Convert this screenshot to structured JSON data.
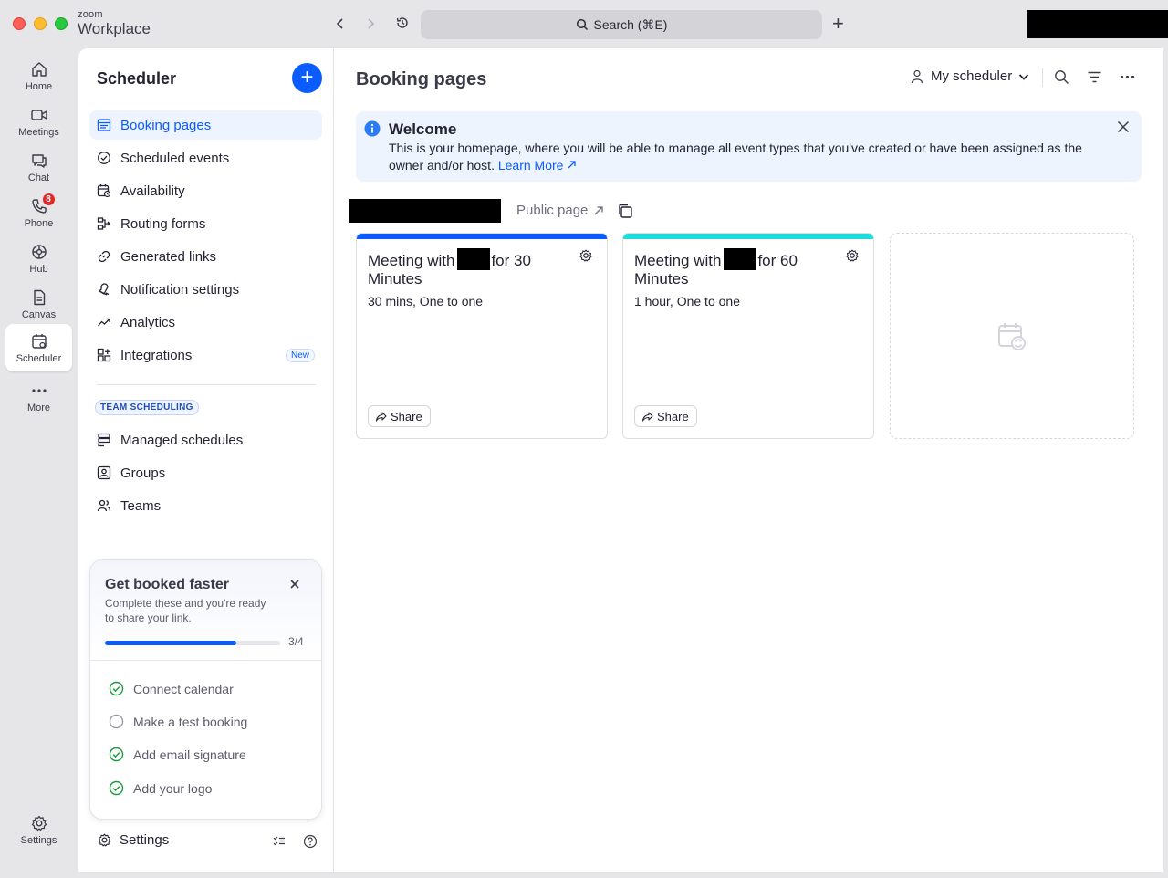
{
  "titlebar": {
    "brand_small": "zoom",
    "brand_big": "Workplace",
    "search_placeholder": "Search (⌘E)"
  },
  "rail": {
    "items": [
      {
        "label": "Home",
        "icon": "home-icon"
      },
      {
        "label": "Meetings",
        "icon": "video-icon"
      },
      {
        "label": "Chat",
        "icon": "chat-icon"
      },
      {
        "label": "Phone",
        "icon": "phone-icon",
        "badge": "8"
      },
      {
        "label": "Hub",
        "icon": "hub-icon"
      },
      {
        "label": "Canvas",
        "icon": "canvas-icon"
      },
      {
        "label": "Scheduler",
        "icon": "calendar-icon",
        "active": true
      },
      {
        "label": "More",
        "icon": "more-icon"
      }
    ],
    "settings_label": "Settings"
  },
  "sidebar": {
    "title": "Scheduler",
    "menu": [
      {
        "label": "Booking pages",
        "icon": "booking-pages-icon",
        "active": true
      },
      {
        "label": "Scheduled events",
        "icon": "check-circle-icon"
      },
      {
        "label": "Availability",
        "icon": "availability-icon"
      },
      {
        "label": "Routing forms",
        "icon": "routing-icon"
      },
      {
        "label": "Generated links",
        "icon": "link-icon"
      },
      {
        "label": "Notification settings",
        "icon": "bell-icon"
      },
      {
        "label": "Analytics",
        "icon": "analytics-icon"
      },
      {
        "label": "Integrations",
        "icon": "integrations-icon",
        "tag": "New"
      }
    ],
    "team_section_label": "TEAM SCHEDULING",
    "team_menu": [
      {
        "label": "Managed schedules",
        "icon": "managed-schedules-icon"
      },
      {
        "label": "Groups",
        "icon": "groups-icon"
      },
      {
        "label": "Teams",
        "icon": "teams-icon"
      }
    ],
    "get_booked": {
      "title": "Get booked faster",
      "subtitle": "Complete these and you're ready to share your link.",
      "progress_label": "3/4",
      "progress_fraction": 0.75,
      "tasks": [
        {
          "label": "Connect calendar",
          "done": true
        },
        {
          "label": "Make a test booking",
          "done": false
        },
        {
          "label": "Add email signature",
          "done": true
        },
        {
          "label": "Add your logo",
          "done": true
        }
      ]
    },
    "settings_label": "Settings"
  },
  "main": {
    "title": "Booking pages",
    "scheduler_select": "My scheduler",
    "welcome": {
      "title": "Welcome",
      "body": "This is your homepage, where you will be able to manage all event types that you've created or have been assigned as the owner and/or host.",
      "link": "Learn More"
    },
    "public_page_label": "Public page",
    "cards": [
      {
        "title_prefix": "Meeting with",
        "title_suffix": "for 30 Minutes",
        "meta": "30 mins, One to one",
        "color": "#0b5cff",
        "share_label": "Share"
      },
      {
        "title_prefix": "Meeting with",
        "title_suffix": "for 60 Minutes",
        "meta": "1 hour, One to one",
        "color": "#1edcdc",
        "share_label": "Share"
      }
    ]
  },
  "colors": {
    "accent": "#0b5cff",
    "success": "#1a9c3e"
  }
}
